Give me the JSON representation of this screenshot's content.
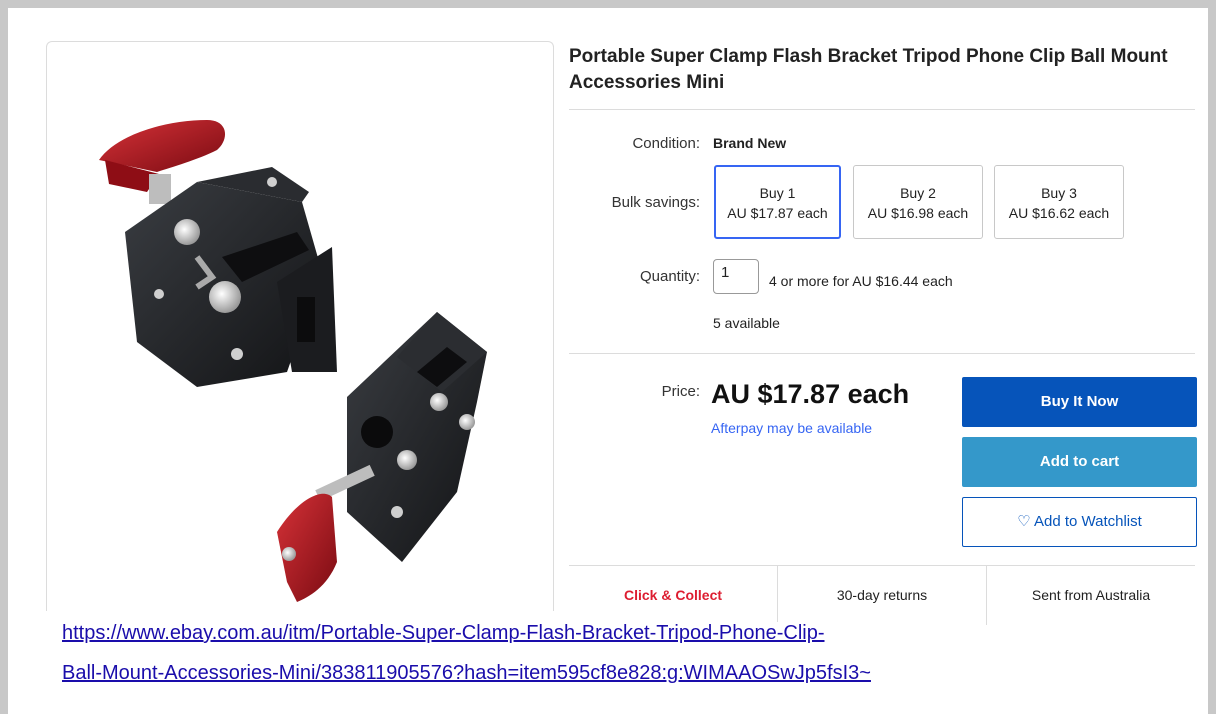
{
  "listing": {
    "title": "Portable Super Clamp Flash Bracket Tripod Phone Clip Ball Mount Accessories Mini",
    "image_alt": "product-photo-super-clamp"
  },
  "details": {
    "condition_label": "Condition:",
    "condition_value": "Brand New",
    "bulk_label": "Bulk savings:",
    "bulk_options": [
      {
        "qty": "Buy 1",
        "price": "AU $17.87 each",
        "selected": true
      },
      {
        "qty": "Buy 2",
        "price": "AU $16.98 each",
        "selected": false
      },
      {
        "qty": "Buy 3",
        "price": "AU $16.62 each",
        "selected": false
      }
    ],
    "quantity_label": "Quantity:",
    "quantity_value": "1",
    "quantity_offer": "4 or more for AU $16.44 each",
    "availability": "5 available"
  },
  "pricing": {
    "price_label": "Price:",
    "price_value": "AU $17.87 each",
    "afterpay_text": "Afterpay may be available"
  },
  "actions": {
    "buy_now": "Buy It Now",
    "add_to_cart": "Add to cart",
    "add_to_watchlist": "♡ Add to Watchlist"
  },
  "features": {
    "click_collect": "Click & Collect",
    "returns": "30-day returns",
    "shipping": "Sent from Australia"
  },
  "link": {
    "line1": "https://www.ebay.com.au/itm/Portable-Super-Clamp-Flash-Bracket-Tripod-Phone-Clip-",
    "line2": "Ball-Mount-Accessories-Mini/383811905576?hash=item595cf8e828:g:WIMAAOSwJp5fsI3~"
  },
  "colors": {
    "accent_blue": "#0654ba",
    "cart_blue": "#3498ca",
    "link_blue": "#3665f3",
    "collect_red": "#dd1e31",
    "knob_red": "#b3111d"
  }
}
